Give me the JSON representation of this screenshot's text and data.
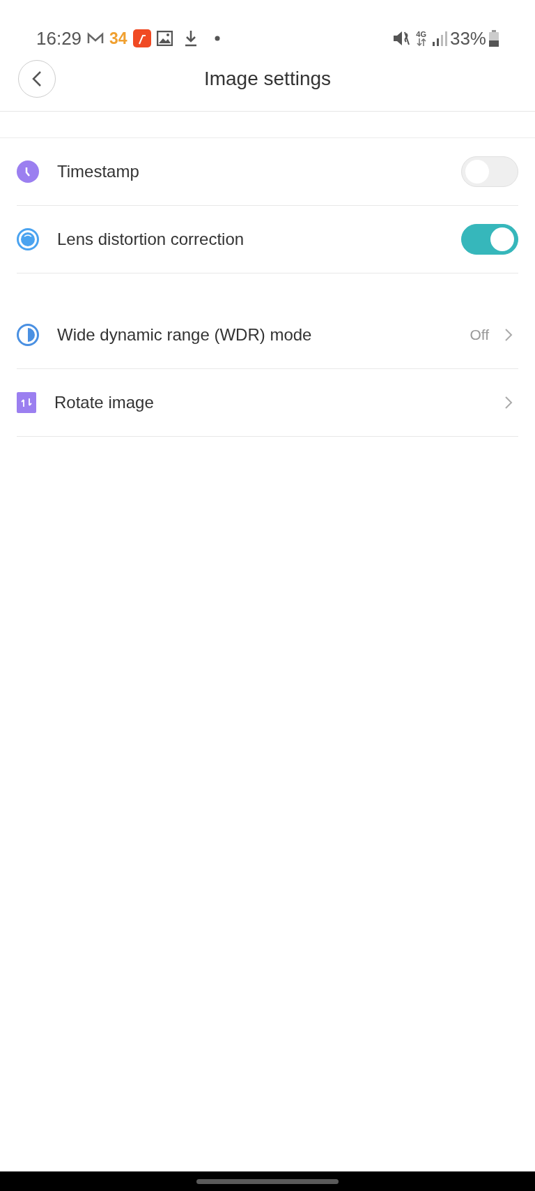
{
  "status_bar": {
    "time": "16:29",
    "notification_count": "34",
    "network": "4G",
    "battery": "33%"
  },
  "header": {
    "title": "Image settings"
  },
  "sections": [
    {
      "items": [
        {
          "kind": "toggle",
          "label": "Timestamp",
          "on": false
        },
        {
          "kind": "toggle",
          "label": "Lens distortion correction",
          "on": true
        }
      ]
    },
    {
      "items": [
        {
          "kind": "link",
          "label": "Wide dynamic range (WDR) mode",
          "value": "Off"
        },
        {
          "kind": "link",
          "label": "Rotate image"
        }
      ]
    }
  ]
}
